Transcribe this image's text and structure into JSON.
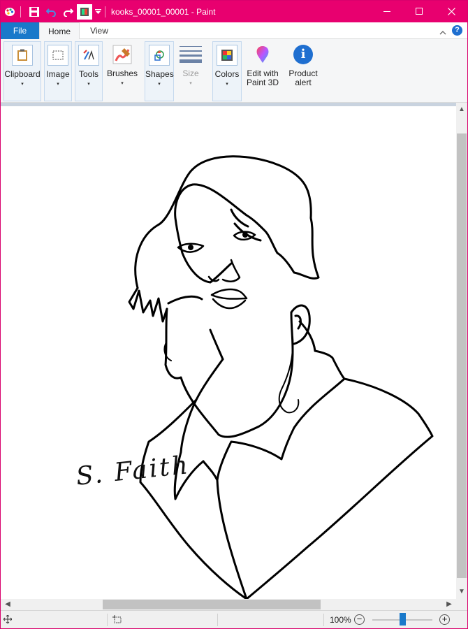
{
  "window": {
    "title": "kooks_00001_00001 - Paint",
    "accent_color": "#e8006f"
  },
  "quick_access": {
    "icons": [
      "paint-app-icon",
      "save-icon",
      "undo-icon",
      "redo-icon",
      "color-swatch-icon",
      "customize-dropdown-icon"
    ]
  },
  "tabs": {
    "file": "File",
    "home": "Home",
    "view": "View"
  },
  "help": {
    "label": "?"
  },
  "ribbon": {
    "clipboard": "Clipboard",
    "image": "Image",
    "tools": "Tools",
    "brushes": "Brushes",
    "shapes": "Shapes",
    "size": "Size",
    "colors": "Colors",
    "edit_paint3d_line1": "Edit with",
    "edit_paint3d_line2": "Paint 3D",
    "product_alert_line1": "Product",
    "product_alert_line2": "alert",
    "dropdown_glyph": "▾",
    "product_alert_icon_text": "i"
  },
  "canvas": {
    "signature": "S. Faith"
  },
  "statusbar": {
    "zoom": "100%",
    "zoom_out": "−",
    "zoom_in": "+",
    "zoom_slider_fraction": 0.5
  },
  "scroll_arrows": {
    "up": "▲",
    "down": "▼",
    "left": "◀",
    "right": "▶"
  }
}
